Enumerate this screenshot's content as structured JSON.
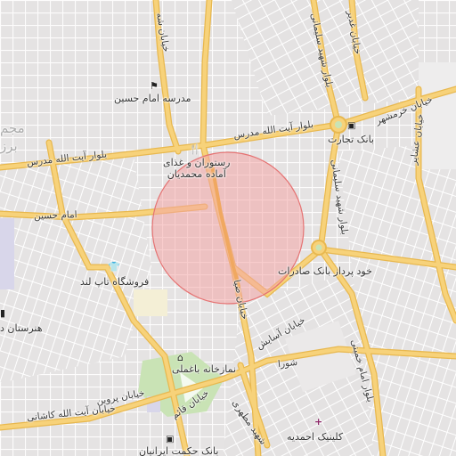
{
  "map": {
    "colors": {
      "background": "#efeded",
      "block_fill": "#e4e2e2",
      "street_minor": "#ffffff",
      "road_major": "#f7d27a",
      "road_major_casing": "#e8b84f",
      "search_circle_fill": "#f4a5a5",
      "search_circle_stroke": "#e57373",
      "highlighted_street": "#f0a860",
      "park": "#c9e3b5",
      "sand_area": "#f4efd6"
    },
    "search_area": {
      "shape": "circle"
    },
    "labels": {
      "blvd_ayatollah_modarres_left": "بلوار آیت الله مدرس",
      "blvd_ayatollah_modarres_mid": "بلوار آیت الله مدرس",
      "khiaban_khorramshahr": "خیابان خرمشهر",
      "blvd_shahid_soleimani_top": "بلوار شهید سلیمانی",
      "blvd_shahid_soleimani_mid": "بلوار شهید سلیمانی",
      "khiaban_shahid_top": "خیابان شه",
      "khiaban_ghadir_top": "خیابان غدیر",
      "khiaban_ashayer": "خیابان عشایر",
      "imam_hossein": "امام حسین",
      "khiaban_ziba": "خیابان ضیا",
      "khiaban_asayesh": "خیابان آسایش",
      "shora": "شورا",
      "blvd_imam_khomeini": "بلوار امام خمینی",
      "khiaban_parvin": "خیابان پروین",
      "khiaban_ghaem": "خیابان قائم",
      "ayatollah_kashani": "خیابان آیت الله کاشانی",
      "shahid_motahari": "شهید مطهری",
      "edge_top_left": "مجم",
      "edge_left": "برز",
      "edge_left_bottom": "هنرستان د"
    },
    "pois": {
      "school_imam_hossein": {
        "icon": "school-icon",
        "label": "مدرسه امام حسین"
      },
      "restaurant": {
        "icon": "restaurant-icon",
        "label_line1": "رستوران و غذای",
        "label_line2": "آماده محمدیان"
      },
      "bank_tejarat": {
        "icon": "bank-icon",
        "label": "بانک تجارت"
      },
      "clothing_store": {
        "icon": "shirt-icon",
        "label": "فروشگاه تاپ لند"
      },
      "atm_saderat": {
        "icon": "atm-icon",
        "label": "خود پرداز بانک صادرات"
      },
      "mosque": {
        "icon": "mosque-icon",
        "label": "نمازخانه باغملی"
      },
      "clinic": {
        "icon": "medical-cross-icon",
        "label": "کلینیک احمدیه"
      },
      "bank_hekmat": {
        "icon": "bank-icon",
        "label": "بانک حکمت ایرانیان"
      },
      "hospital_left": {
        "icon": "hospital-icon",
        "label": "هنرستان د"
      }
    }
  }
}
